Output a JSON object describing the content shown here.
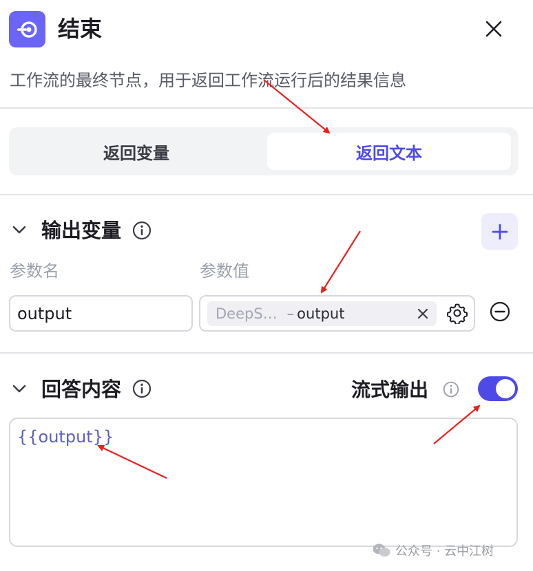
{
  "header": {
    "title": "结束",
    "description": "工作流的最终节点，用于返回工作流运行后的结果信息"
  },
  "mode_tabs": {
    "items": [
      "返回变量",
      "返回文本"
    ],
    "selected": "返回文本"
  },
  "output_section": {
    "title": "输出变量",
    "col_name": "参数名",
    "col_value": "参数值",
    "param_name": "output",
    "param_source": "DeepS…",
    "param_separator": "–",
    "param_var": "output"
  },
  "answer_section": {
    "title": "回答内容",
    "stream_label": "流式输出",
    "stream_enabled": true,
    "content": "{{output}}"
  },
  "watermark": {
    "text": "公众号 · 云中江树"
  },
  "colors": {
    "accent": "#4d4ae8",
    "icon_bg": "#6a64f7",
    "annotation_arrow": "#e8201d"
  }
}
